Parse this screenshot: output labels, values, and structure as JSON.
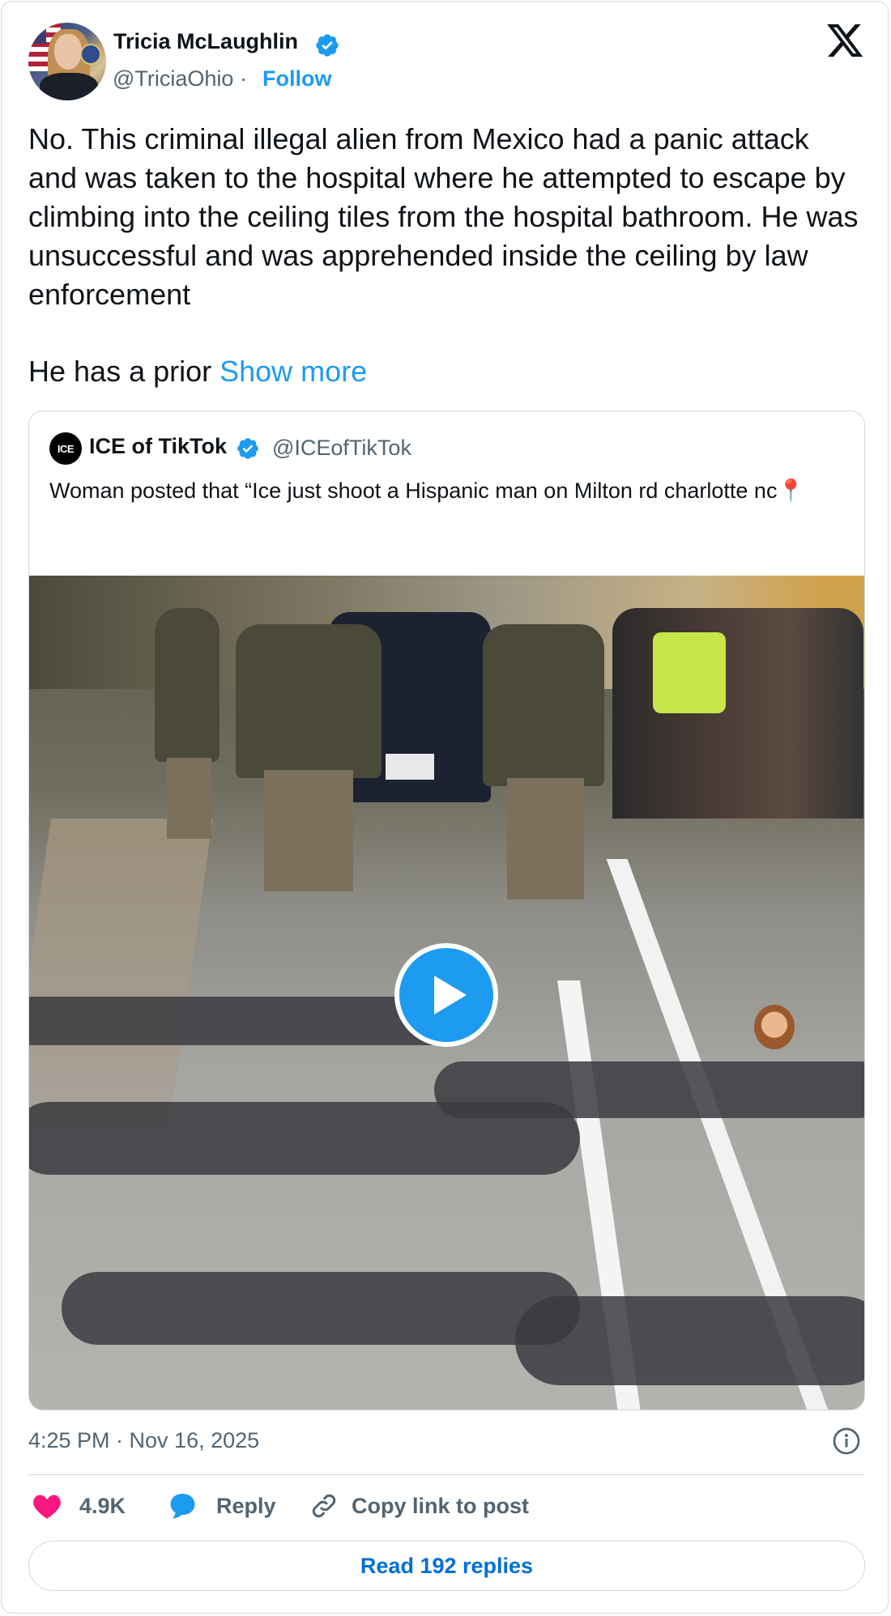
{
  "author": {
    "name": "Tricia McLaughlin",
    "handle": "@TriciaOhio",
    "separator": "·",
    "follow_label": "Follow"
  },
  "tweet": {
    "text": "No. This criminal illegal alien from Mexico had a panic attack and was taken to the hospital where he attempted to escape by climbing into the ceiling tiles from the hospital bathroom. He was unsuccessful and was apprehended inside the ceiling by law enforcement",
    "text_2": "He has a prior",
    "show_more_label": "Show more"
  },
  "quote": {
    "avatar_text": "ICE",
    "name": "ICE of TikTok",
    "handle": "@ICEofTikTok",
    "text": "Woman posted that “Ice just shoot a Hispanic man on Milton rd charlotte nc📍"
  },
  "meta": {
    "timestamp": "4:25 PM · Nov 16, 2025"
  },
  "actions": {
    "likes": "4.9K",
    "reply_label": "Reply",
    "copy_label": "Copy link to post",
    "read_replies_label": "Read 192 replies"
  },
  "colors": {
    "accent": "#1d9bf0",
    "like": "#f91880",
    "text": "#0f1419",
    "secondary": "#536471"
  },
  "icons": [
    "verified-badge-icon",
    "x-logo-icon",
    "play-icon",
    "info-icon",
    "heart-icon",
    "reply-bubble-icon",
    "link-icon"
  ]
}
